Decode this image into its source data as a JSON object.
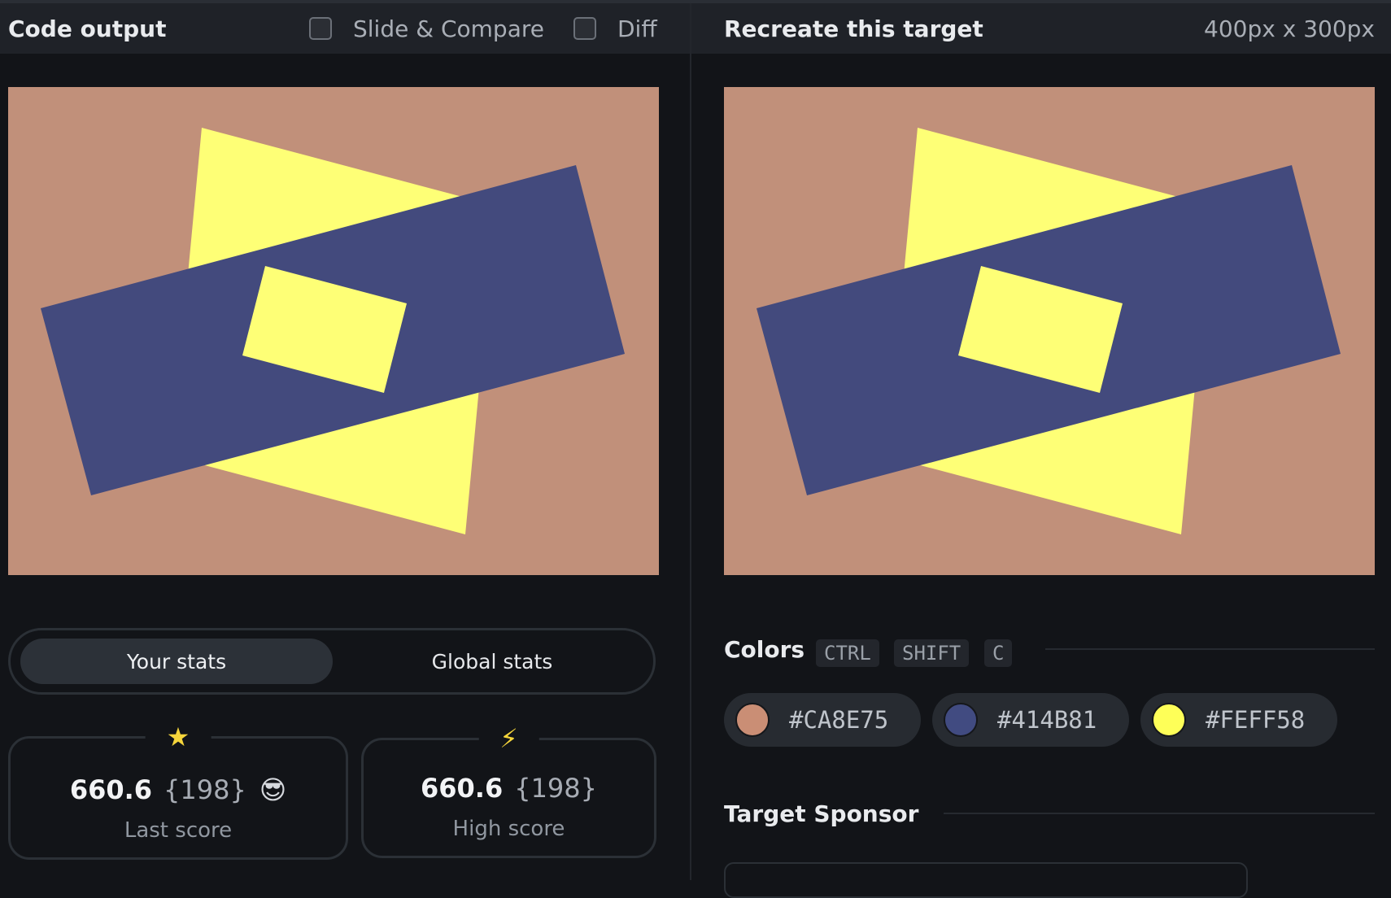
{
  "header": {
    "code_output_title": "Code output",
    "slide_compare_label": "Slide & Compare",
    "diff_label": "Diff",
    "target_title": "Recreate this target",
    "target_size": "400px x 300px"
  },
  "stats": {
    "tab_your": "Your stats",
    "tab_global": "Global stats",
    "last": {
      "score": "660.6",
      "chars": "{198}",
      "label": "Last score",
      "emoji": "😎",
      "icon": "★"
    },
    "high": {
      "score": "660.6",
      "chars": "{198}",
      "label": "High score",
      "icon": "⚡"
    }
  },
  "colors": {
    "title": "Colors",
    "shortcut_keys": [
      "CTRL",
      "SHIFT",
      "C"
    ],
    "swatches": [
      {
        "hex": "#CA8E75",
        "color": "#CA8E75"
      },
      {
        "hex": "#414B81",
        "color": "#414B81"
      },
      {
        "hex": "#FEFF58",
        "color": "#FEFF58"
      }
    ]
  },
  "sponsor": {
    "title": "Target Sponsor"
  },
  "art": {
    "background": "#C1907A",
    "yellow": "#FEFF76",
    "navy": "#434A7D"
  }
}
